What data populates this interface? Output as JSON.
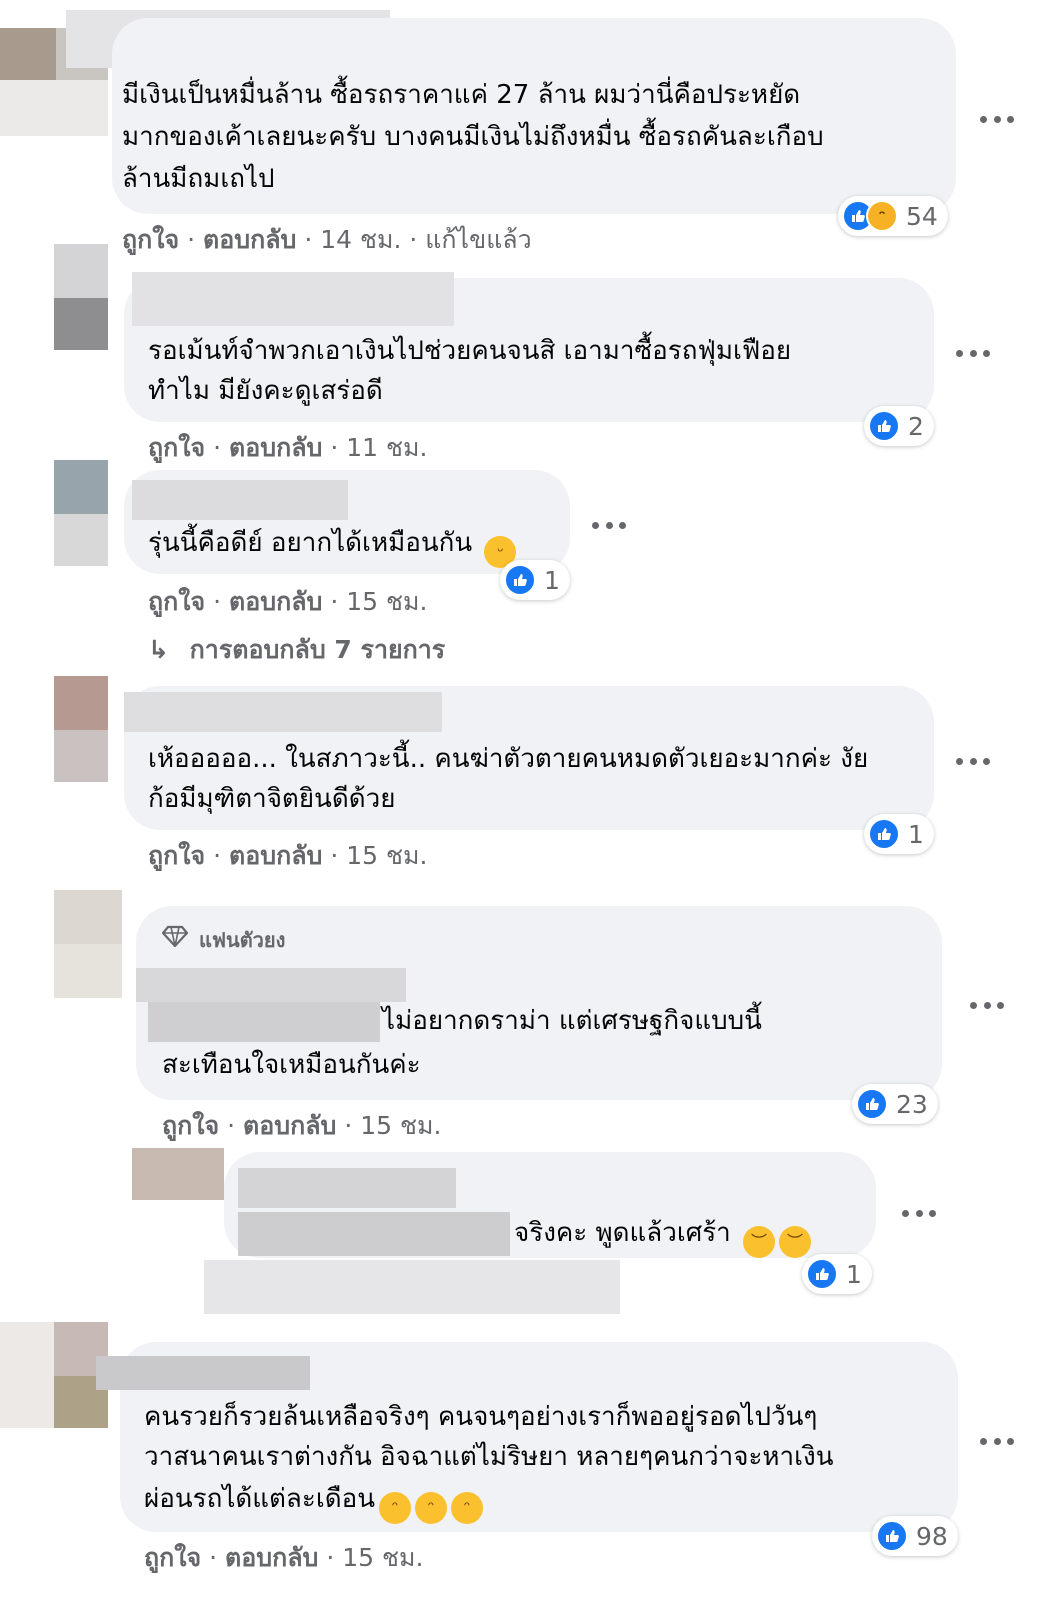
{
  "comments": [
    {
      "text_lines": [
        "มีเงินเป็นหมื่นล้าน ซื้อรถราคาแค่ 27 ล้าน ผมว่านี่คือประหยัด",
        "มากของเค้าเลยนะครับ บางคนมีเงินไม่ถึงหมื่น ซื้อรถคันละเกือบ",
        "ล้านมีถมเถไป"
      ],
      "like": "ถูกใจ",
      "reply": "ตอบกลับ",
      "time": "14 ชม.",
      "edited": "แก้ไขแล้ว",
      "reaction_count": "54",
      "reactions": [
        "like-icon",
        "haha-icon"
      ]
    },
    {
      "text_lines": [
        "รอเม้นท์จำพวกเอาเงินไปช่วยคนจนสิ เอามาซื้อรถฟุ่มเฟือย",
        "ทำไม มียังคะดูเสร่อดี"
      ],
      "like": "ถูกใจ",
      "reply": "ตอบกลับ",
      "time": "11 ชม.",
      "reaction_count": "2",
      "reactions": [
        "like-icon"
      ]
    },
    {
      "text_lines": [
        "รุ่นนี้คือดีย์ อยากได้เหมือนกัน"
      ],
      "like": "ถูกใจ",
      "reply": "ตอบกลับ",
      "time": "15 ชม.",
      "reaction_count": "1",
      "reactions": [
        "like-icon"
      ],
      "emoji": [
        "grin-emoji"
      ],
      "replies_link": "การตอบกลับ 7 รายการ"
    },
    {
      "text_lines": [
        "เห้อออออ... ในสภาวะนี้.. คนฆ่าตัวตายคนหมดตัวเยอะมากค่ะ งัย",
        "ก้อมีมุฑิตาจิตยินดีด้วย"
      ],
      "like": "ถูกใจ",
      "reply": "ตอบกลับ",
      "time": "15 ชม.",
      "reaction_count": "1",
      "reactions": [
        "like-icon"
      ]
    },
    {
      "badge": "แฟนตัวยง",
      "text_lines": [
        "ไม่อยากดราม่า แต่เศรษฐกิจแบบนี้",
        "สะเทือนใจเหมือนกันค่ะ"
      ],
      "like": "ถูกใจ",
      "reply": "ตอบกลับ",
      "time": "15 ชม.",
      "reaction_count": "23",
      "reactions": [
        "like-icon"
      ]
    },
    {
      "text_lines": [
        "จริงคะ พูดแล้วเศร้า"
      ],
      "emoji": [
        "sad-emoji",
        "sad-emoji"
      ],
      "reaction_count": "1",
      "reactions": [
        "like-icon"
      ]
    },
    {
      "text_lines": [
        "คนรวยก็รวยล้นเหลือจริงๆ คนจนๆอย่างเราก็พออยู่รอดไปวันๆ",
        "วาสนาคนเราต่างกัน อิจฉาแต่ไม่ริษยา หลายๆคนกว่าจะหาเงิน",
        "ผ่อนรถได้แต่ละเดือน"
      ],
      "emoji": [
        "sweat-smile-emoji",
        "sweat-smile-emoji",
        "sweat-smile-emoji"
      ],
      "like": "ถูกใจ",
      "reply": "ตอบกลับ",
      "time": "15 ชม.",
      "reaction_count": "98",
      "reactions": [
        "like-icon"
      ]
    }
  ],
  "colors": {
    "bubble": "#f0f2f5",
    "meta_text": "#65676b",
    "like_blue": "#1877f2",
    "emoji_yellow": "#fbc02d"
  }
}
